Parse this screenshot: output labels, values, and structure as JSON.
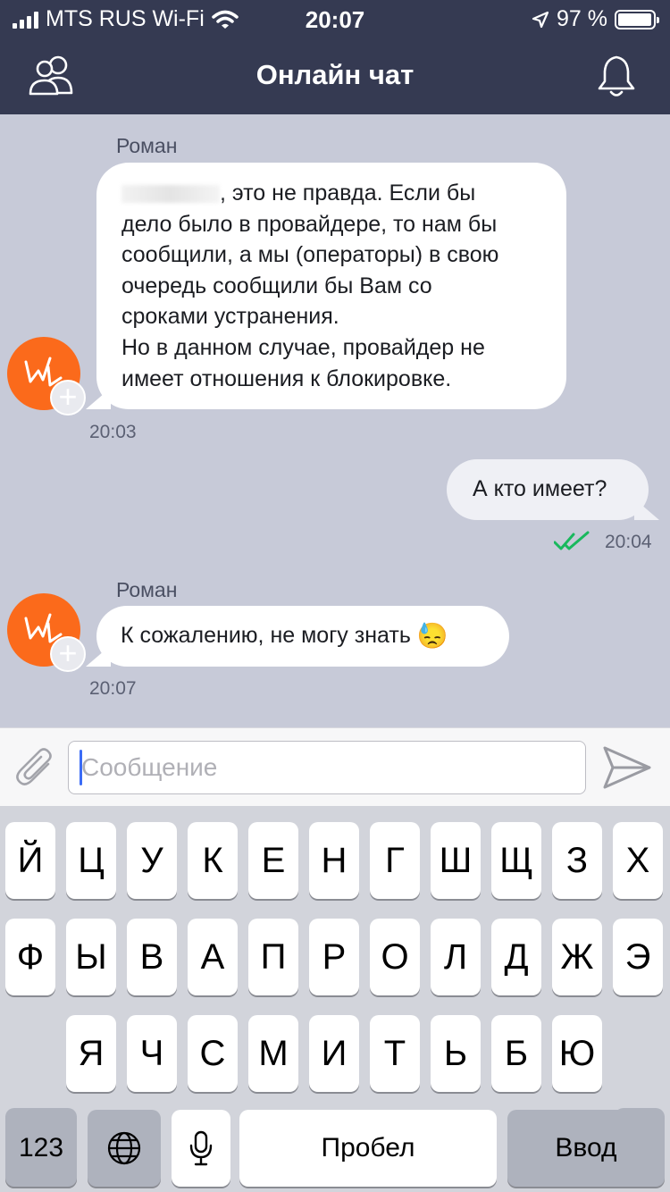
{
  "status_bar": {
    "carrier": "MTS RUS Wi-Fi",
    "time": "20:07",
    "battery": "97 %",
    "battery_level": 0.97
  },
  "header": {
    "title": "Онлайн чат",
    "left_icon": "users-icon",
    "right_icon": "bell-icon"
  },
  "messages": [
    {
      "sender": "Роман",
      "direction": "incoming",
      "lines": [
        "это не правда. Если бы",
        "дело было в провайдере, то нам бы",
        "сообщили, а мы (операторы) в свою",
        "очередь сообщили бы Вам со",
        "сроками устранения.",
        "Но в данном случае, провайдер не",
        "имеет отношения к блокировке."
      ],
      "time": "20:03"
    },
    {
      "direction": "outgoing",
      "text": "А кто имеет?",
      "time": "20:04",
      "status_icon": "double-check-icon"
    },
    {
      "sender": "Роман",
      "direction": "incoming",
      "text": "К сожалению, не могу знать",
      "emoji": "😓",
      "time": "20:07"
    }
  ],
  "input": {
    "placeholder": "Сообщение",
    "value": ""
  },
  "keyboard": {
    "row1": [
      "Й",
      "Ц",
      "У",
      "К",
      "Е",
      "Н",
      "Г",
      "Ш",
      "Щ",
      "З",
      "Х"
    ],
    "row2": [
      "Ф",
      "Ы",
      "В",
      "А",
      "П",
      "Р",
      "О",
      "Л",
      "Д",
      "Ж",
      "Э"
    ],
    "row3": [
      "Я",
      "Ч",
      "С",
      "М",
      "И",
      "Т",
      "Ь",
      "Б",
      "Ю"
    ],
    "numbers_label": "123",
    "space_label": "Пробел",
    "return_label": "Ввод"
  },
  "colors": {
    "header_bg": "#353a52",
    "chat_bg": "#c7cad8",
    "avatar": "#fb6a1b",
    "check": "#19b85d",
    "cursor": "#3b6cf6"
  }
}
